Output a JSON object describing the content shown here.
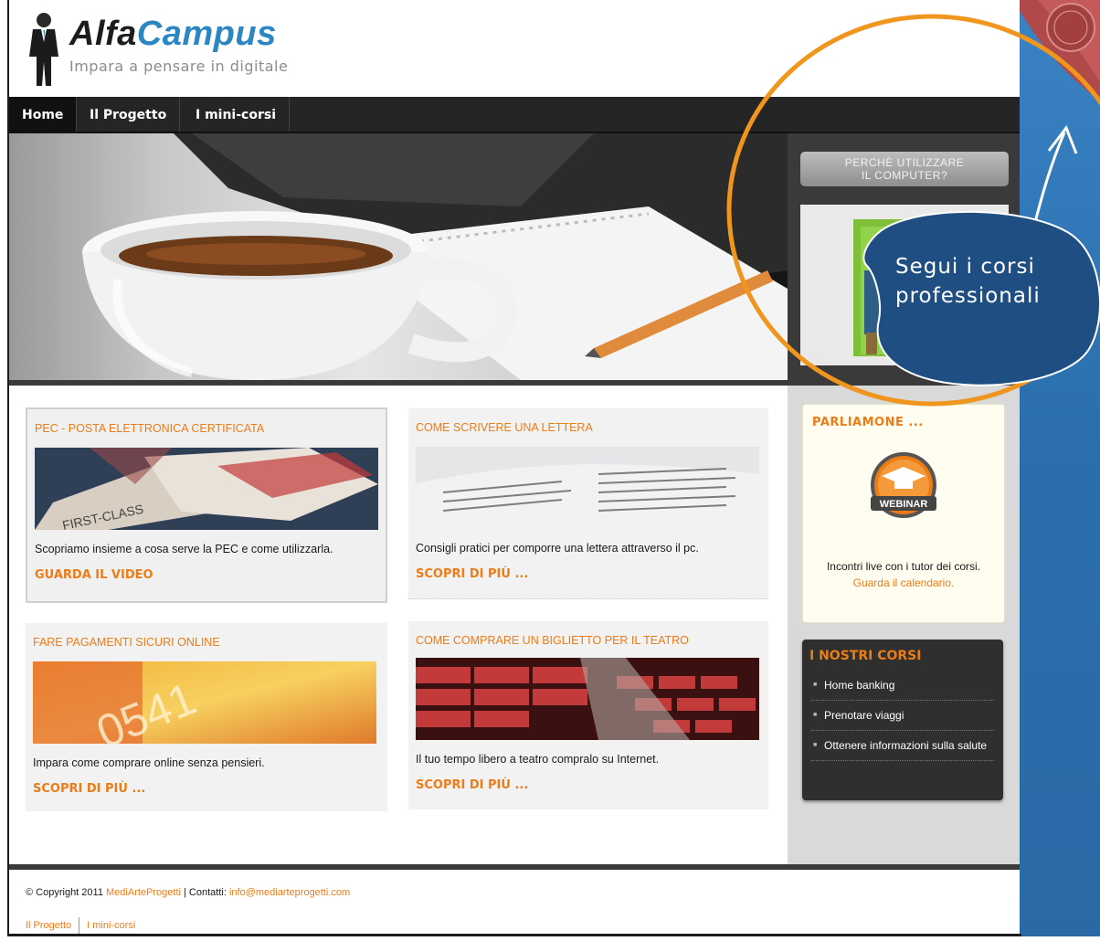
{
  "header": {
    "logo_alfa": "Alfa",
    "logo_campus": "Campus",
    "tagline": "Impara a pensare in digitale"
  },
  "nav": {
    "items": [
      {
        "label": "Home",
        "active": true
      },
      {
        "label": "Il Progetto",
        "active": false
      },
      {
        "label": "I mini-corsi",
        "active": false
      }
    ]
  },
  "sidebar": {
    "why_button": "PERCHÈ UTILIZZARE\nIL COMPUTER?",
    "bubble_line1": "Segui i corsi",
    "bubble_line2": "professionali",
    "talk": {
      "title": "PARLIAMONE ...",
      "badge": "WEBINAR",
      "text": "Incontri live con i tutor dei corsi.",
      "link": "Guarda il calendario."
    },
    "courses": {
      "title": "I NOSTRI CORSI",
      "items": [
        "Home banking",
        "Prenotare viaggi",
        "Ottenere informazioni sulla salute"
      ]
    }
  },
  "cards": [
    {
      "title": "PEC - POSTA ELETTRONICA CERTIFICATA",
      "text": "Scopriamo insieme a cosa serve la PEC e come utilizzarla.",
      "link": "GUARDA IL VIDEO",
      "img_text": "FIRST-CLASS"
    },
    {
      "title": "COME SCRIVERE UNA LETTERA",
      "text": "Consigli pratici per comporre una lettera attraverso il pc.",
      "link": "SCOPRI DI PIÙ ..."
    },
    {
      "title": "FARE PAGAMENTI SICURI ONLINE",
      "text": "Impara come comprare online senza pensieri.",
      "link": "SCOPRI DI PIÙ ...",
      "img_text": "0541"
    },
    {
      "title": "COME COMPRARE UN BIGLIETTO PER IL TEATRO",
      "text": "Il tuo tempo libero a teatro compralo su Internet.",
      "link": "SCOPRI DI PIÙ ..."
    }
  ],
  "footer": {
    "copyright": "© Copyright 2011",
    "company": "MediArteProgetti",
    "contacts_label": "| Contatti:",
    "email": "info@mediarteprogetti.com",
    "links": [
      "Il Progetto",
      "I mini-corsi"
    ]
  },
  "colors": {
    "accent_orange": "#ec7c17",
    "brand_blue": "#2c86c2",
    "nav_dark": "#252525",
    "bubble_blue": "#1f4f82"
  }
}
